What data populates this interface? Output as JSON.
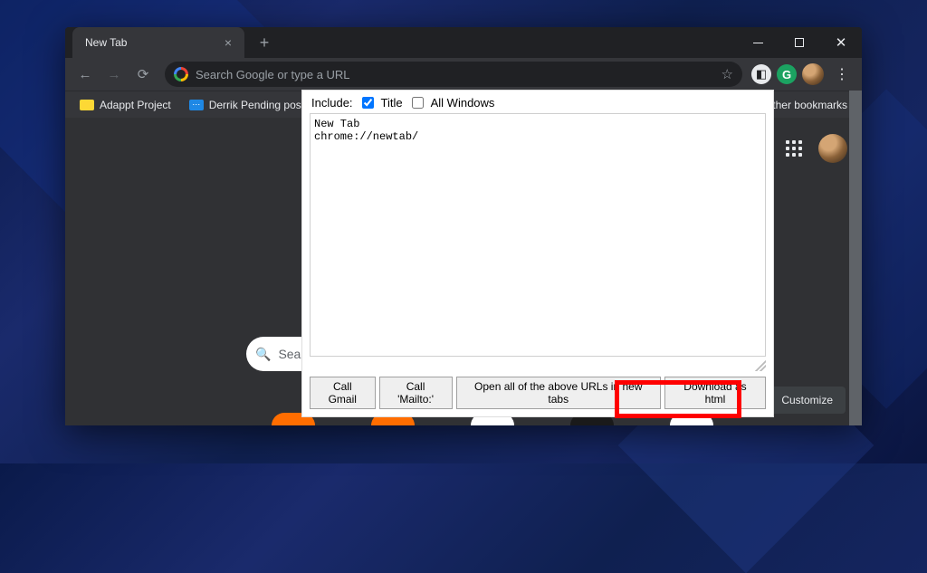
{
  "titlebar": {
    "tab_title": "New Tab",
    "close_glyph": "×",
    "new_tab_glyph": "+",
    "min_glyph": "",
    "max_glyph": "",
    "close_window_glyph": "✕"
  },
  "toolbar": {
    "back_glyph": "←",
    "forward_glyph": "→",
    "reload_glyph": "⟳",
    "omnibox_placeholder": "Search Google or type a URL",
    "star_glyph": "☆",
    "ext_tag_glyph": "◧",
    "ext_g_glyph": "G",
    "menu_glyph": "⋮"
  },
  "bookmarks": {
    "items": [
      {
        "label": "Adappt Project",
        "icon": "yellow"
      },
      {
        "label": "Derrik Pending posts",
        "icon": "blue"
      },
      {
        "label": "",
        "icon": "blue"
      }
    ],
    "other_label": "Other bookmarks"
  },
  "content": {
    "search_prefix": "Sea",
    "search_icon": "🔍",
    "customize_label": "Customize"
  },
  "popup": {
    "include_label": "Include:",
    "title_label": "Title",
    "title_checked": true,
    "all_windows_label": "All Windows",
    "all_windows_checked": false,
    "textarea_value": "New Tab\nchrome://newtab/",
    "buttons": {
      "call_gmail": "Call Gmail",
      "call_mailto": "Call 'Mailto:'",
      "open_all": "Open all of the above URLs in new tabs",
      "download_html": "Download as html"
    }
  }
}
